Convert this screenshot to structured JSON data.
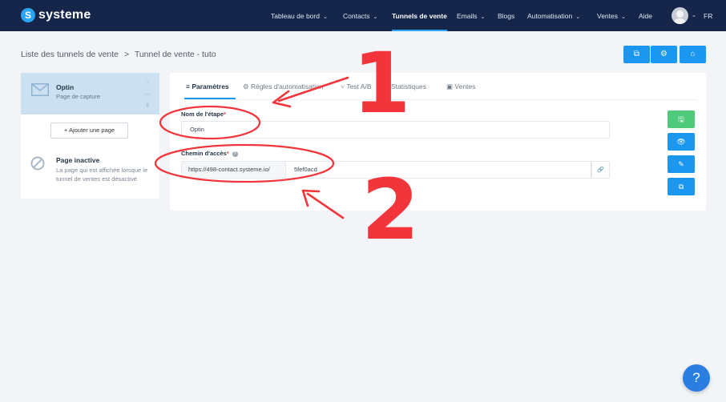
{
  "brand": {
    "name": "systeme",
    "mark": "S"
  },
  "nav": {
    "items": [
      {
        "label": "Tableau de bord",
        "caret": "⌄"
      },
      {
        "label": "Contacts",
        "caret": "⌄"
      },
      {
        "label": "Tunnels de vente",
        "caret": ""
      },
      {
        "label": "Emails",
        "caret": "⌄"
      },
      {
        "label": "Blogs",
        "caret": ""
      },
      {
        "label": "Automatisation",
        "caret": "⌄"
      },
      {
        "label": "Ventes",
        "caret": "⌄"
      },
      {
        "label": "Aide",
        "caret": ""
      }
    ],
    "active": "Tunnels de vente",
    "avatar_caret": "⌄",
    "language": "FR"
  },
  "breadcrumb": {
    "parent": "Liste des tunnels de vente",
    "separator": ">",
    "current": "Tunnel de vente - tuto"
  },
  "top_actions": [
    {
      "icon": "external-link-icon",
      "glyph": "⧉"
    },
    {
      "icon": "gear-icon",
      "glyph": "⚙"
    },
    {
      "icon": "shop-icon",
      "glyph": "⌂"
    }
  ],
  "steps": {
    "current": {
      "title": "Optin",
      "subtitle": "Page de capture",
      "icon": "envelope-icon"
    },
    "add_button": "+ Ajouter une page",
    "inactive": {
      "title": "Page inactive",
      "description": "La page qui est affichée lorsque le tunnel de ventes est désactivé",
      "icon": "ban-icon"
    }
  },
  "tabs": [
    {
      "label": "Paramètres",
      "glyph": "≡"
    },
    {
      "label": "Règles d'automatisation",
      "glyph": "⚙"
    },
    {
      "label": "Test A/B",
      "glyph": "⑂"
    },
    {
      "label": "Statistiques",
      "glyph": ""
    },
    {
      "label": "Ventes",
      "glyph": "▣"
    }
  ],
  "form": {
    "step_name_label": "Nom de l'étape",
    "step_name_value": "Optin",
    "path_label": "Chemin d'accès",
    "path_help": "?",
    "path_prefix": "https://498-contact.systeme.io/",
    "path_value": "5fef0acd",
    "required_mark": "*",
    "link_glyph": "🔗"
  },
  "side_actions": [
    {
      "icon": "save-icon",
      "glyph": "🖫",
      "color": "#4fca7a"
    },
    {
      "icon": "eye-icon",
      "glyph": "👁",
      "color": "#1b97f0"
    },
    {
      "icon": "edit-icon",
      "glyph": "✎",
      "color": "#1b97f0"
    },
    {
      "icon": "copy-icon",
      "glyph": "⧉",
      "color": "#1b97f0"
    }
  ],
  "annotations": {
    "one": "1",
    "two": "2",
    "color": "#f2353a"
  },
  "help_button": "?"
}
